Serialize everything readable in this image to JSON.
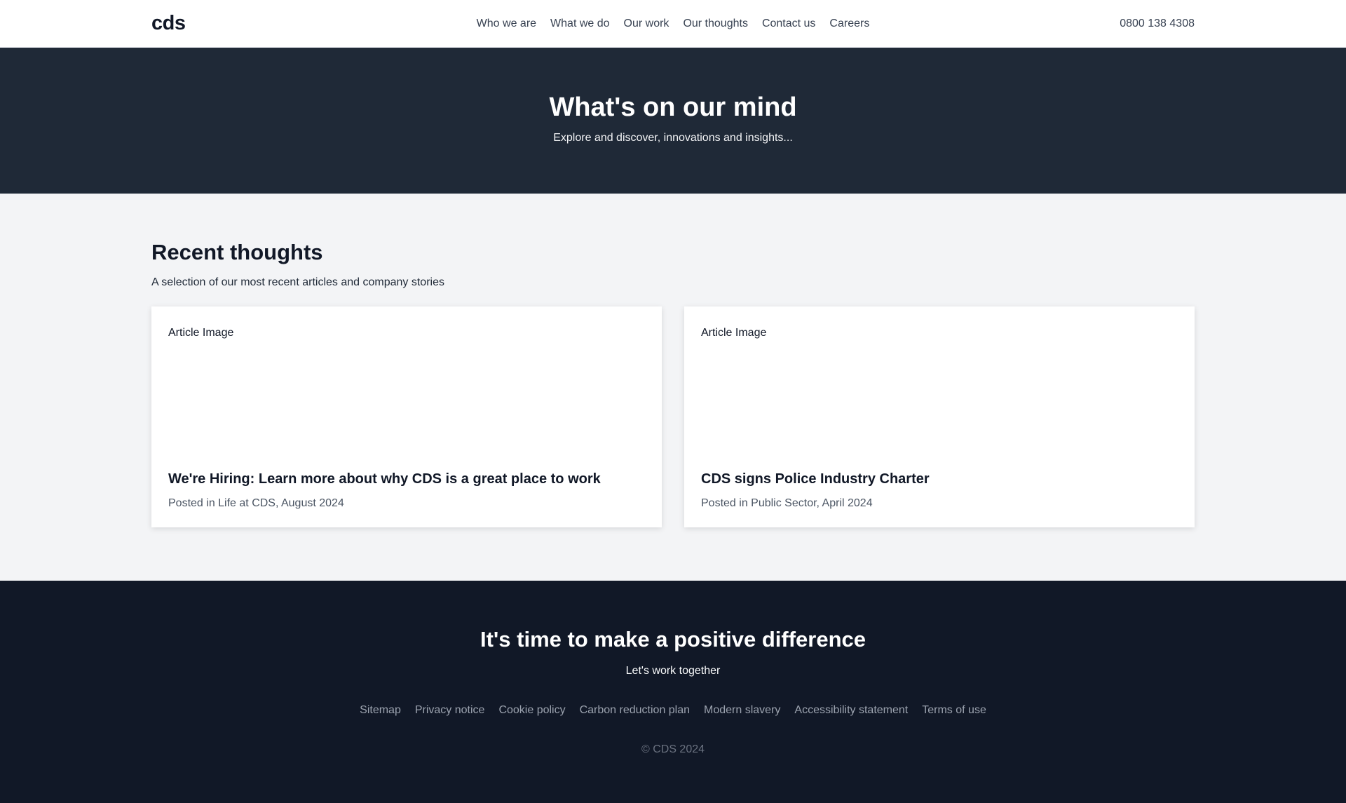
{
  "header": {
    "logo": "cds",
    "nav": [
      {
        "label": "Who we are"
      },
      {
        "label": "What we do"
      },
      {
        "label": "Our work"
      },
      {
        "label": "Our thoughts"
      },
      {
        "label": "Contact us"
      },
      {
        "label": "Careers"
      }
    ],
    "phone": "0800 138 4308"
  },
  "hero": {
    "title": "What's on our mind",
    "subtitle": "Explore and discover, innovations and insights..."
  },
  "recent": {
    "title": "Recent thoughts",
    "subtitle": "A selection of our most recent articles and company stories",
    "articles": [
      {
        "image_label": "Article Image",
        "title": "We're Hiring: Learn more about why CDS is a great place to work",
        "meta": "Posted in Life at CDS, August 2024"
      },
      {
        "image_label": "Article Image",
        "title": "CDS signs Police Industry Charter",
        "meta": "Posted in Public Sector, April 2024"
      }
    ]
  },
  "footer": {
    "title": "It's time to make a positive difference",
    "tagline": "Let's work together",
    "links": [
      {
        "label": "Sitemap"
      },
      {
        "label": "Privacy notice"
      },
      {
        "label": "Cookie policy"
      },
      {
        "label": "Carbon reduction plan"
      },
      {
        "label": "Modern slavery"
      },
      {
        "label": "Accessibility statement"
      },
      {
        "label": "Terms of use"
      }
    ],
    "copyright": "© CDS 2024"
  },
  "colors": {
    "hero_bg": "#1f2937",
    "footer_bg": "#111827",
    "section_bg": "#f3f4f6"
  }
}
